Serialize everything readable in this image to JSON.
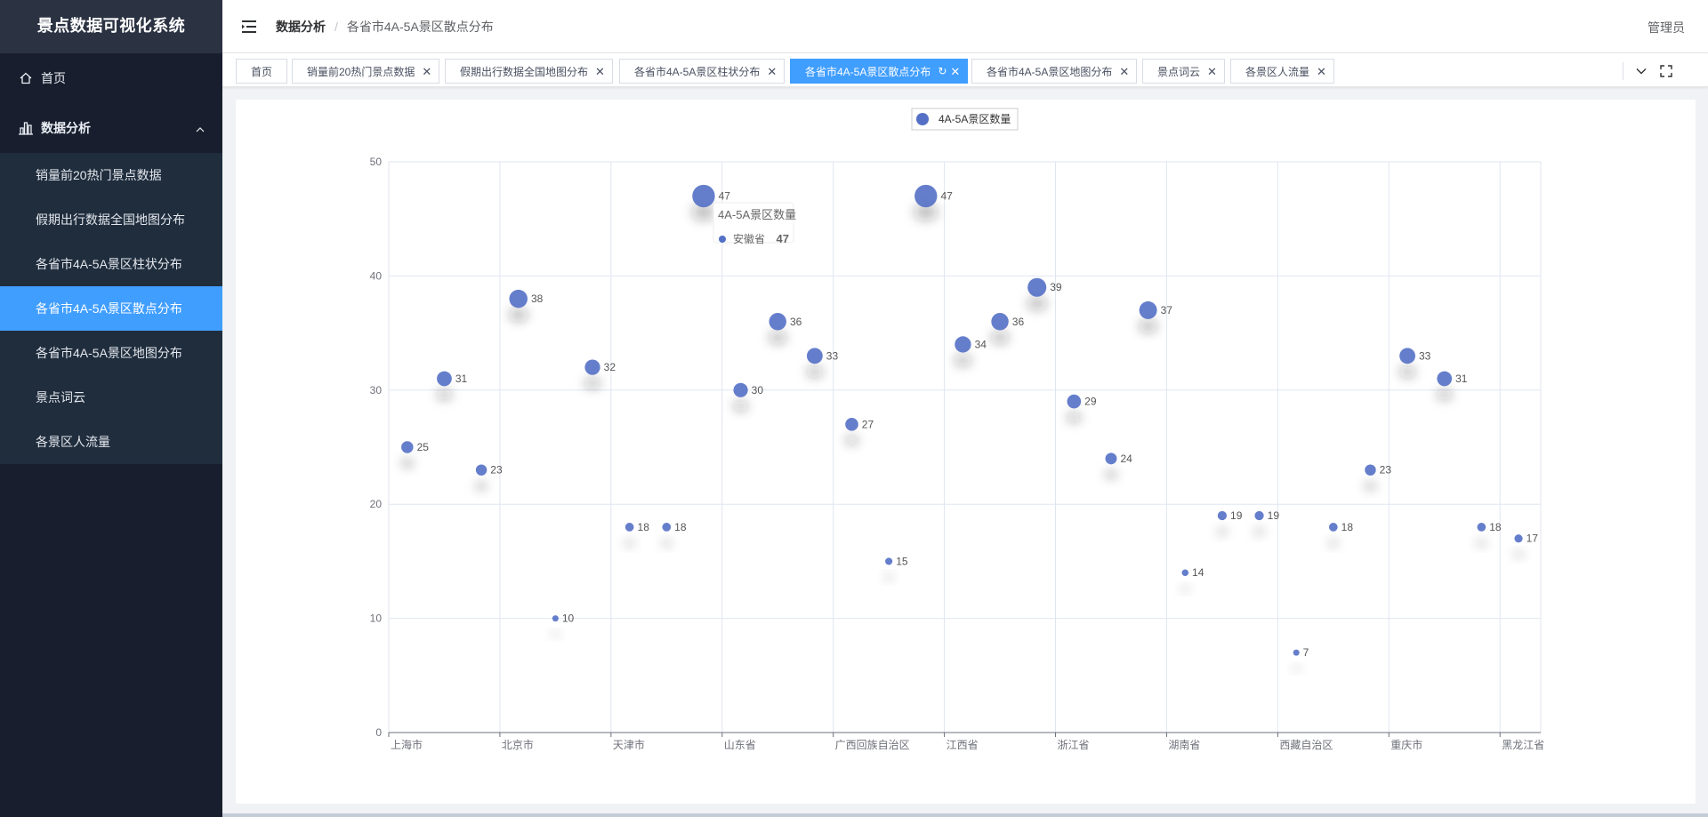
{
  "app": {
    "title": "景点数据可视化系统"
  },
  "sidebar": {
    "home": "首页",
    "group": "数据分析",
    "items": [
      {
        "label": "销量前20热门景点数据"
      },
      {
        "label": "假期出行数据全国地图分布"
      },
      {
        "label": "各省市4A-5A景区柱状分布"
      },
      {
        "label": "各省市4A-5A景区散点分布",
        "active": true
      },
      {
        "label": "各省市4A-5A景区地图分布"
      },
      {
        "label": "景点词云"
      },
      {
        "label": "各景区人流量"
      }
    ]
  },
  "header": {
    "breadcrumb": [
      "数据分析",
      "各省市4A-5A景区散点分布"
    ],
    "user": "管理员"
  },
  "tags": [
    {
      "label": "首页"
    },
    {
      "label": "销量前20热门景点数据"
    },
    {
      "label": "假期出行数据全国地图分布"
    },
    {
      "label": "各省市4A-5A景区柱状分布"
    },
    {
      "label": "各省市4A-5A景区散点分布",
      "active": true
    },
    {
      "label": "各省市4A-5A景区地图分布"
    },
    {
      "label": "景点词云"
    },
    {
      "label": "各景区人流量"
    }
  ],
  "colors": {
    "accent": "#409eff",
    "sidebar_bg": "#191e2e",
    "point": "#5470c6"
  },
  "chart_data": {
    "type": "scatter",
    "legend": "4A-5A景区数量",
    "x_tick_labels": [
      "上海市",
      "北京市",
      "天津市",
      "山东省",
      "广西回族自治区",
      "江西省",
      "浙江省",
      "湖南省",
      "西藏自治区",
      "重庆市",
      "黑龙江省"
    ],
    "ylim": [
      0,
      50
    ],
    "yticks": [
      0,
      10,
      20,
      30,
      40,
      50
    ],
    "grid": true,
    "legend_position": "top-center",
    "series": [
      {
        "name": "4A-5A景区数量",
        "values": [
          25,
          31,
          23,
          38,
          10,
          32,
          18,
          18,
          47,
          30,
          36,
          33,
          27,
          15,
          47,
          34,
          36,
          39,
          29,
          24,
          37,
          14,
          19,
          19,
          7,
          18,
          23,
          33,
          31,
          18,
          17
        ]
      }
    ],
    "tooltip": {
      "title": "4A-5A景区数量",
      "name": "安徽省",
      "value": "47"
    }
  }
}
